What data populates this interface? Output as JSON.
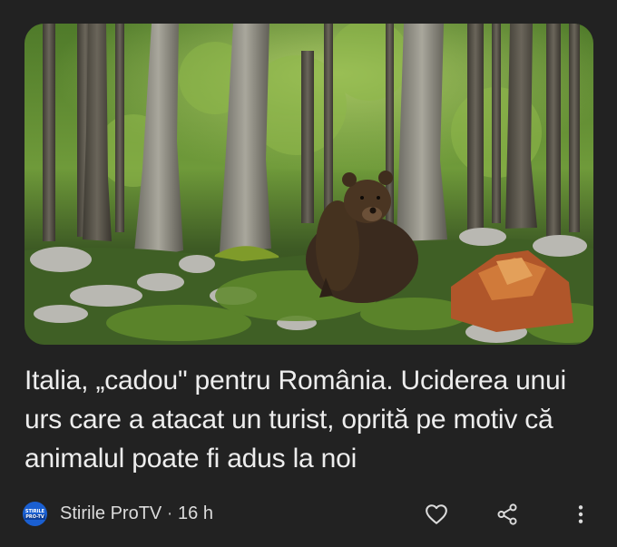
{
  "article": {
    "image_alt": "Brown bear sitting in a beech forest",
    "headline": "Italia, „cadou\" pentru România. Uciderea unui urs care a atacat un turist, oprită pe motiv că animalul poate fi adus la noi"
  },
  "source": {
    "logo_text_top": "STIRILE",
    "logo_text_bottom": "PRO-TV",
    "name": "Stirile ProTV",
    "separator": " · ",
    "age": "16 h",
    "logo_color": "#1a5fd1"
  },
  "actions": {
    "like_icon": "heart-icon",
    "share_icon": "share-icon",
    "more_icon": "more-vert-icon"
  },
  "colors": {
    "background": "#222222",
    "text": "#ededed"
  }
}
